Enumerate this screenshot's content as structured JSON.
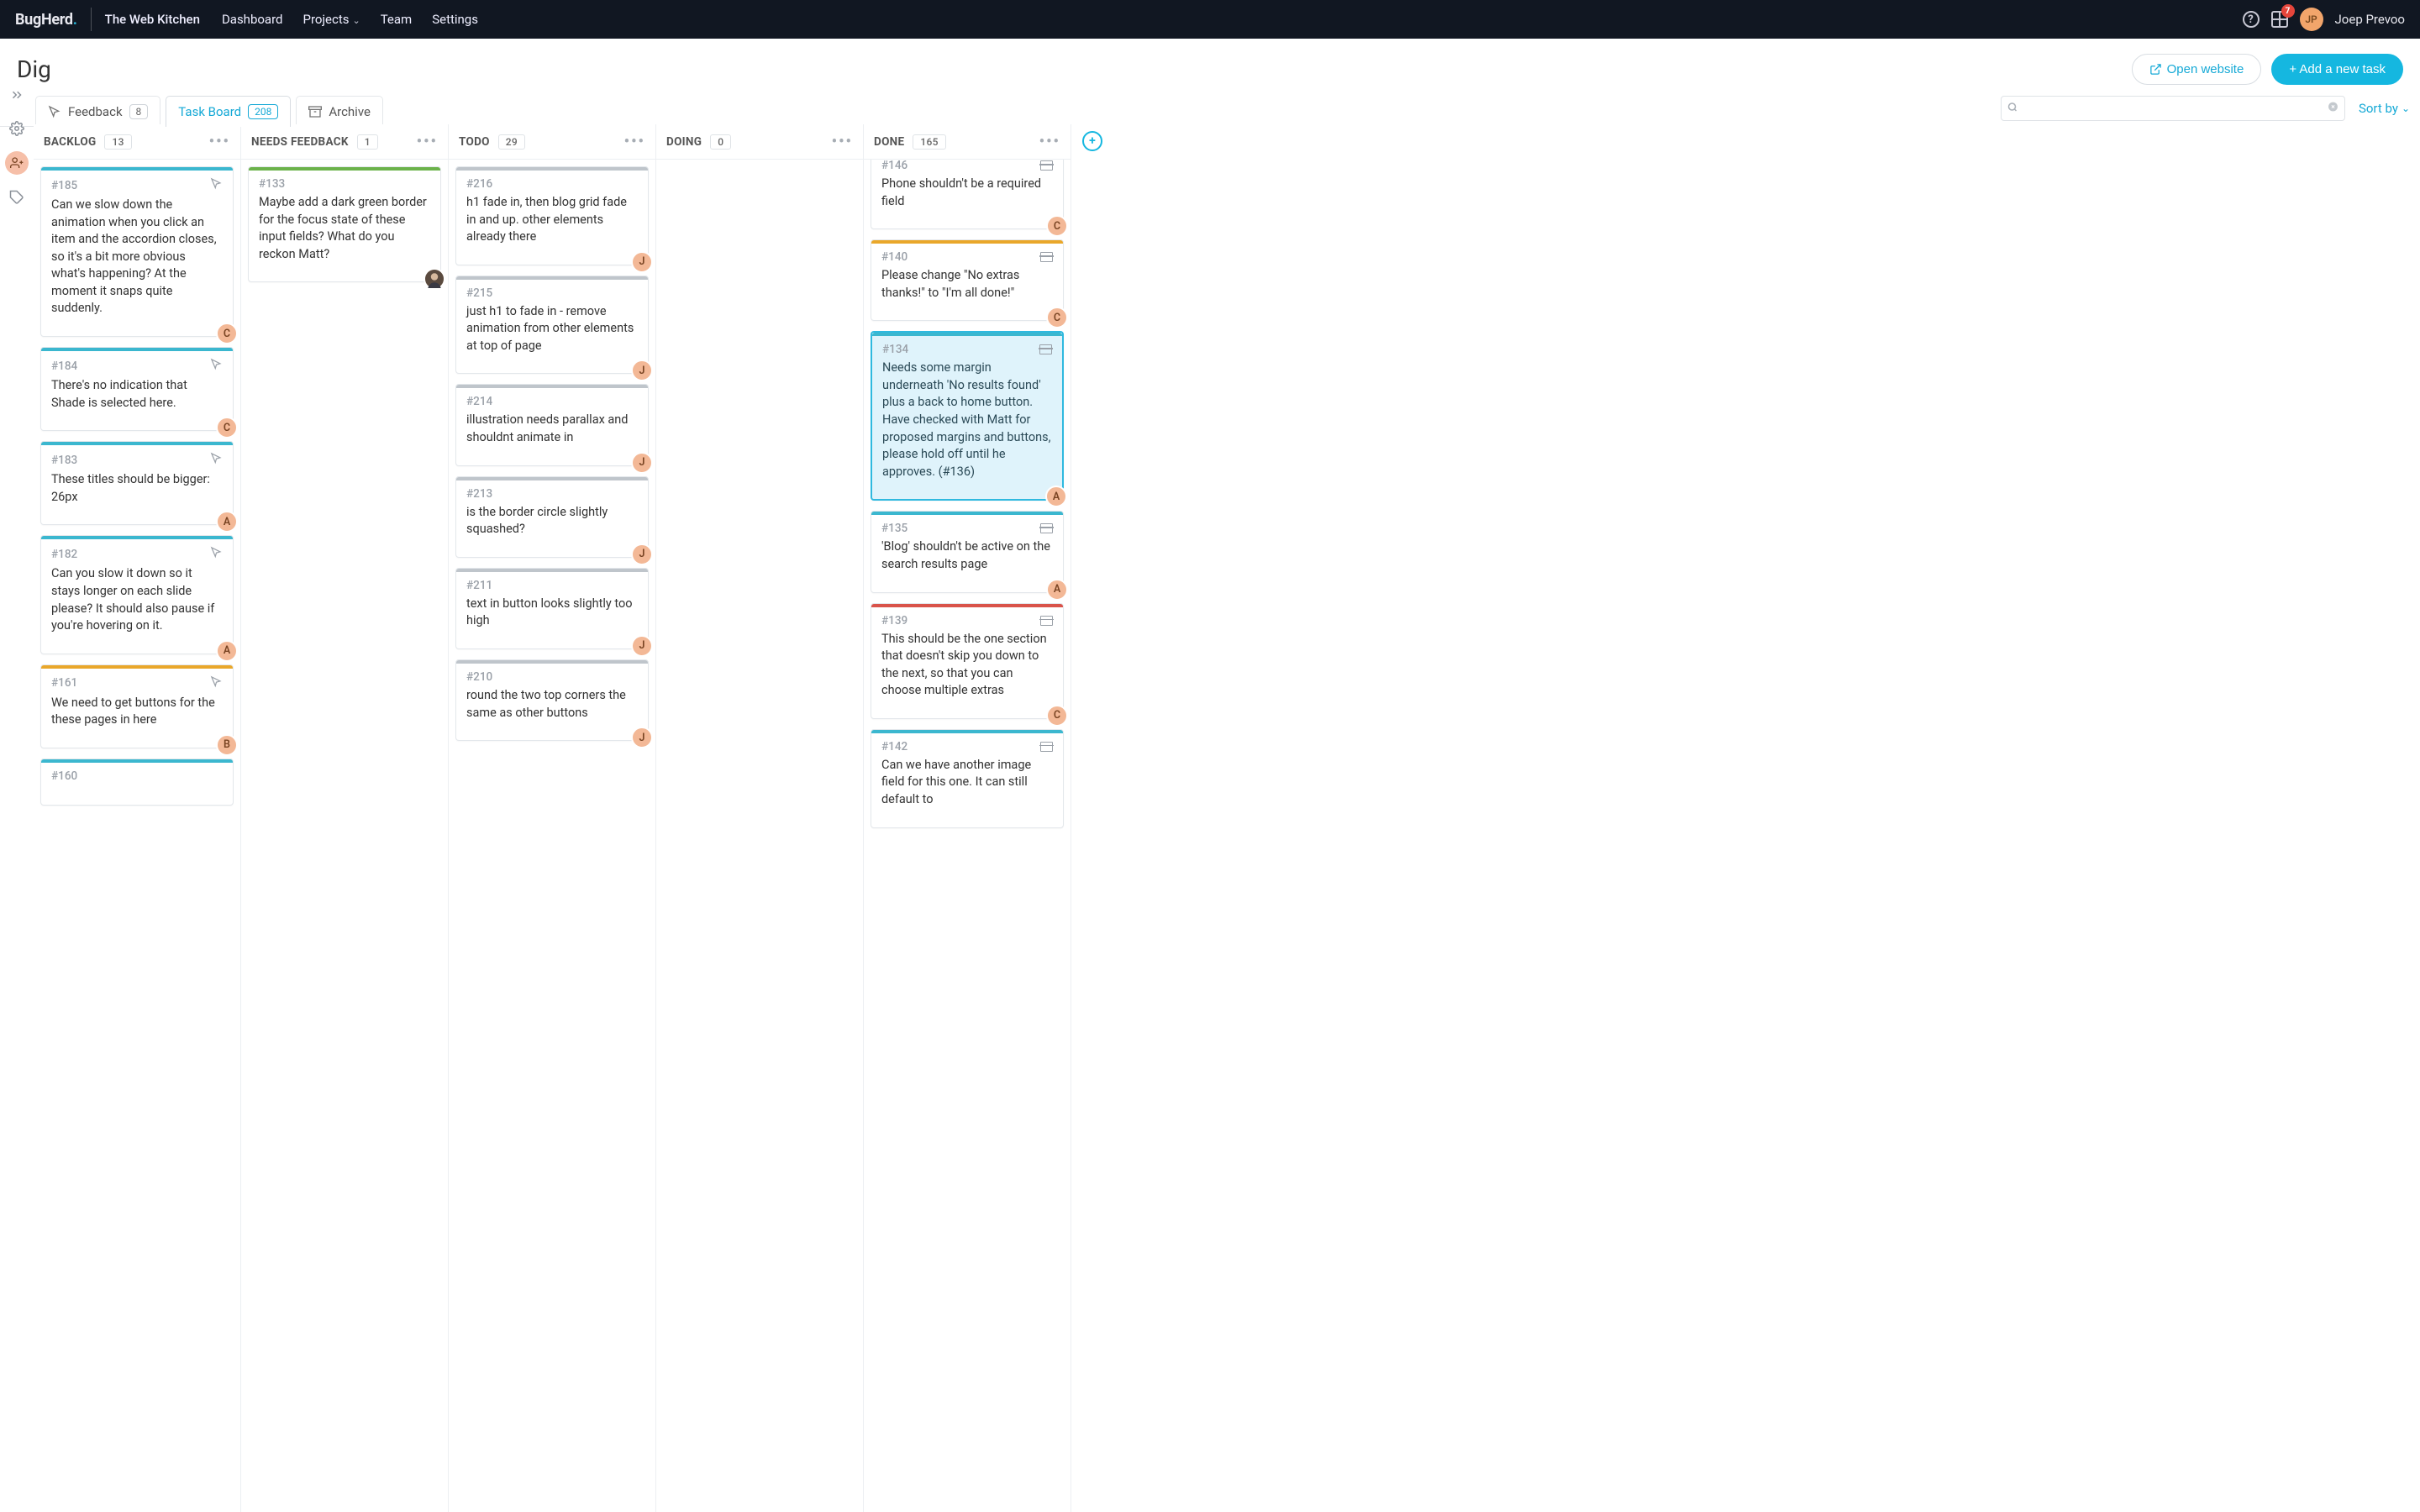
{
  "nav": {
    "logo": "BugHerd",
    "org": "The Web Kitchen",
    "links": [
      "Dashboard",
      "Projects",
      "Team",
      "Settings"
    ],
    "notif_count": "7",
    "user_name": "Joep Prevoo"
  },
  "project": {
    "title": "Dig",
    "open_website": "Open website",
    "new_task": "+ Add a new task"
  },
  "views": {
    "feedback": {
      "label": "Feedback",
      "count": "8"
    },
    "task_board": {
      "label": "Task Board",
      "count": "208"
    },
    "archive": {
      "label": "Archive"
    }
  },
  "search": {
    "placeholder": ""
  },
  "sort_by": "Sort by",
  "columns": {
    "backlog": {
      "title": "BACKLOG",
      "count": "13"
    },
    "needs_feedback": {
      "title": "NEEDS FEEDBACK",
      "count": "1"
    },
    "todo": {
      "title": "TODO",
      "count": "29"
    },
    "doing": {
      "title": "DOING",
      "count": "0"
    },
    "done": {
      "title": "DONE",
      "count": "165"
    }
  },
  "cards": {
    "c185": {
      "id": "#185",
      "text": "Can we slow down the animation when you click an item and the accordion closes, so it's a bit more obvious what's happening? At the moment it snaps quite suddenly.",
      "assignee": "C"
    },
    "c184": {
      "id": "#184",
      "text": "There's no indication that Shade is selected here.",
      "assignee": "C"
    },
    "c183": {
      "id": "#183",
      "text": "These titles should be bigger: 26px",
      "assignee": "A"
    },
    "c182": {
      "id": "#182",
      "text": "Can you slow it down so it stays longer on each slide please? It should also pause if you're hovering on it.",
      "assignee": "A"
    },
    "c161": {
      "id": "#161",
      "text": "We need to get buttons for the these pages in here",
      "assignee": "B"
    },
    "c160": {
      "id": "#160",
      "text": ""
    },
    "c133": {
      "id": "#133",
      "text": "Maybe add a dark green border for the focus state of these input fields? What do you reckon Matt?"
    },
    "c216": {
      "id": "#216",
      "text": "h1 fade in, then blog grid fade in and up. other elements already there",
      "assignee": "J"
    },
    "c215": {
      "id": "#215",
      "text": "just h1 to fade in - remove animation from other elements at top of page",
      "assignee": "J"
    },
    "c214": {
      "id": "#214",
      "text": "illustration needs parallax and shouldnt animate in",
      "assignee": "J"
    },
    "c213": {
      "id": "#213",
      "text": "is the border circle slightly squashed?",
      "assignee": "J"
    },
    "c211": {
      "id": "#211",
      "text": "text in button looks slightly too high",
      "assignee": "J"
    },
    "c210": {
      "id": "#210",
      "text": "round the two top corners the same as other buttons",
      "assignee": "J"
    },
    "c146": {
      "id": "#146",
      "text": "Phone shouldn't be a required field",
      "assignee": "C"
    },
    "c140": {
      "id": "#140",
      "text": "Please change \"No extras thanks!\" to \"I'm all done!\"",
      "assignee": "C"
    },
    "c134": {
      "id": "#134",
      "text": "Needs some margin underneath 'No results found' plus a back to home button. Have checked with Matt for proposed margins and buttons, please hold off until he approves. (#136)",
      "assignee": "A"
    },
    "c135": {
      "id": "#135",
      "text": "'Blog' shouldn't be active on the search results page",
      "assignee": "A"
    },
    "c139": {
      "id": "#139",
      "text": "This should be the one section that doesn't skip you down to the next, so that you can choose multiple extras",
      "assignee": "C"
    },
    "c142": {
      "id": "#142",
      "text": "Can we have another image field for this one. It can still default to"
    }
  }
}
